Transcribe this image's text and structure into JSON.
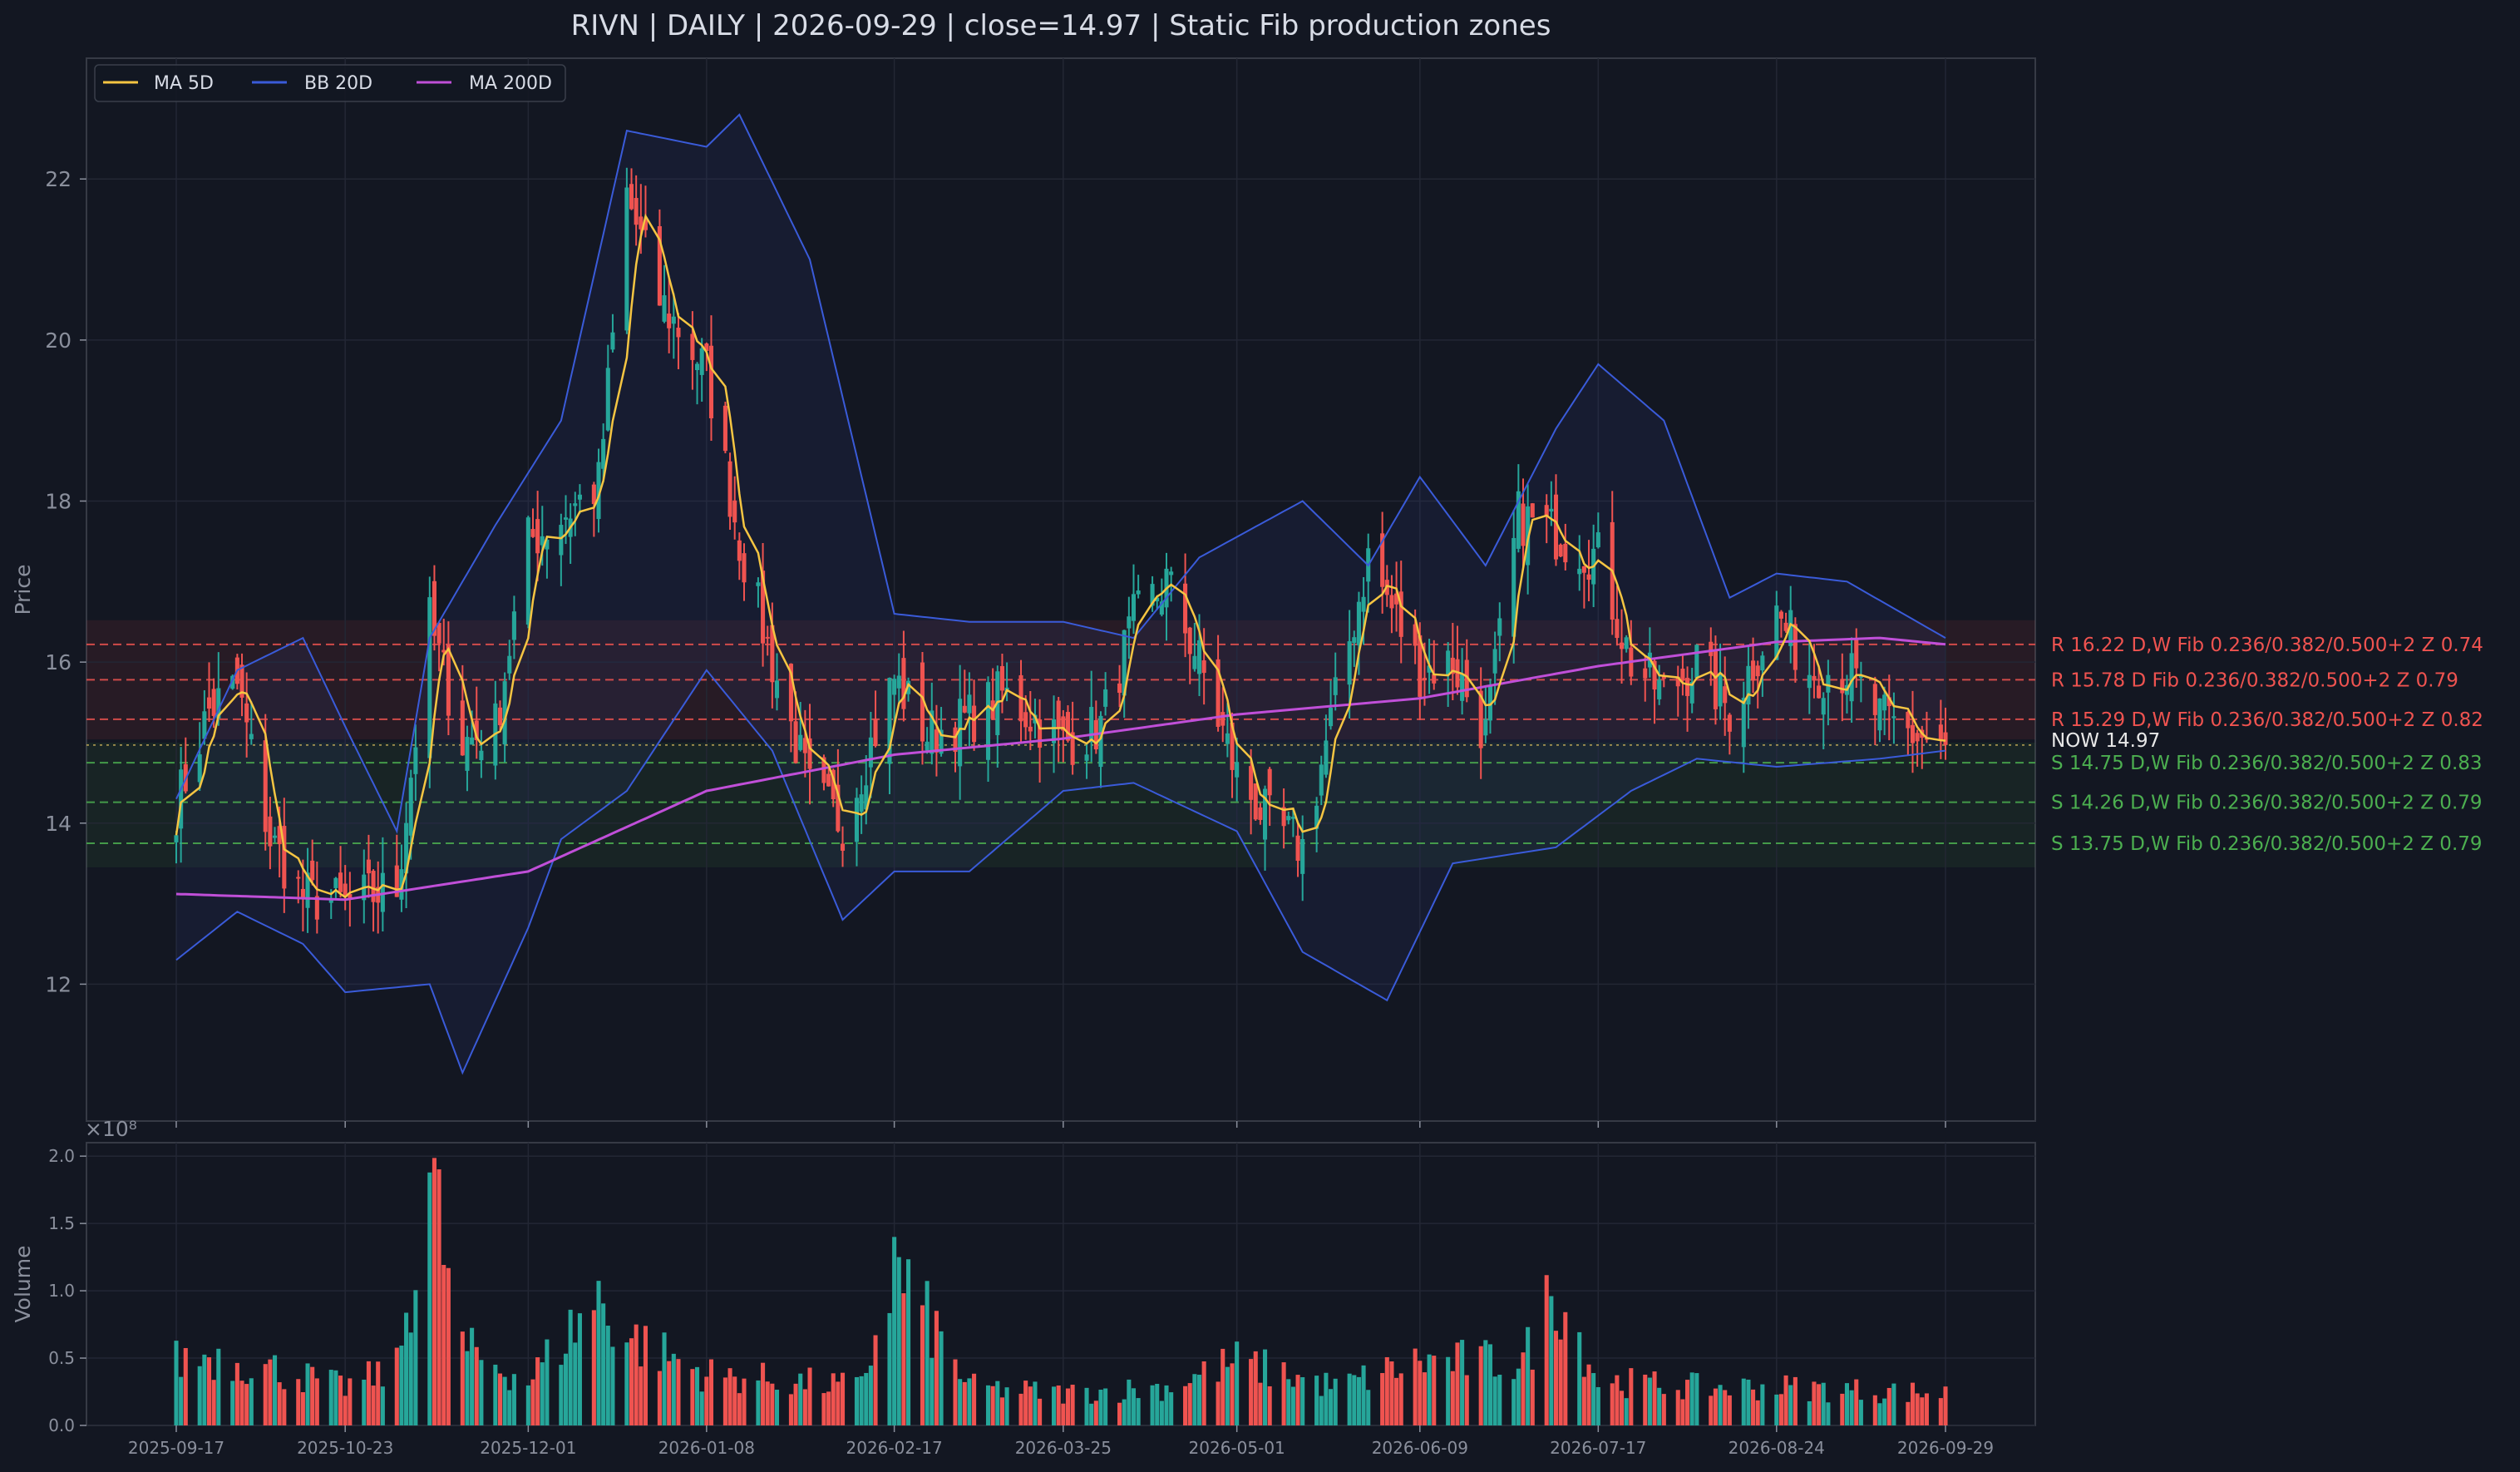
{
  "chart_data": {
    "type": "candlestick",
    "title": "RIVN  |  DAILY  |  2026-09-29  |  close=14.97  |  Static Fib production zones",
    "ylabel": "Price",
    "volume_ylabel": "Volume",
    "volume_multiplier_label": "×10⁸",
    "ylim": [
      10.3,
      23.5
    ],
    "yticks": [
      12,
      14,
      16,
      18,
      20,
      22
    ],
    "volume_ylim": [
      0,
      2.1
    ],
    "volume_yticks": [
      "0.0",
      "0.5",
      "1.0",
      "1.5",
      "2.0"
    ],
    "x_tick_labels": [
      "2025-09-17",
      "2025-10-23",
      "2025-12-01",
      "2026-01-08",
      "2026-02-17",
      "2026-03-25",
      "2026-05-01",
      "2026-06-09",
      "2026-07-17",
      "2026-08-24",
      "2026-09-29"
    ],
    "legend": [
      {
        "name": "MA 5D",
        "color": "#f5c542"
      },
      {
        "name": "BB 20D",
        "color": "#3a5bd9"
      },
      {
        "name": "MA 200D",
        "color": "#c04fd8"
      }
    ],
    "legend_position": "top-left",
    "grid": true,
    "close_price": 14.97,
    "now_label": "NOW 14.97",
    "zones": [
      {
        "level": 16.22,
        "label": "R 16.22  D,W  Fib 0.236/0.382/0.500+2  Z 0.74",
        "kind": "resistance"
      },
      {
        "level": 15.78,
        "label": "R 15.78  D  Fib 0.236/0.382/0.500+2  Z 0.79",
        "kind": "resistance"
      },
      {
        "level": 15.29,
        "label": "R 15.29  D,W  Fib 0.236/0.382/0.500+2  Z 0.82",
        "kind": "resistance"
      },
      {
        "level": 14.75,
        "label": "S 14.75  D,W  Fib 0.236/0.382/0.500+2  Z 0.83",
        "kind": "support"
      },
      {
        "level": 14.26,
        "label": "S 14.26  D,W  Fib 0.236/0.382/0.500+2  Z 0.79",
        "kind": "support"
      },
      {
        "level": 13.75,
        "label": "S 13.75  D,W  Fib 0.236/0.382/0.500+2  Z 0.79",
        "kind": "support"
      }
    ],
    "colors": {
      "up": "#26a69a",
      "down": "#ef5350",
      "resistance": "#ef5350",
      "support": "#4caf50",
      "background": "#131722"
    },
    "close_anchors": [
      [
        "2025-09-17",
        14.2
      ],
      [
        "2025-09-24",
        15.4
      ],
      [
        "2025-09-30",
        15.7
      ],
      [
        "2025-10-07",
        13.8
      ],
      [
        "2025-10-14",
        13.1
      ],
      [
        "2025-10-23",
        13.0
      ],
      [
        "2025-11-03",
        13.2
      ],
      [
        "2025-11-10",
        16.5
      ],
      [
        "2025-11-17",
        15.0
      ],
      [
        "2025-11-24",
        15.2
      ],
      [
        "2025-12-01",
        17.5
      ],
      [
        "2025-12-08",
        17.8
      ],
      [
        "2025-12-16",
        18.2
      ],
      [
        "2025-12-22",
        21.8
      ],
      [
        "2025-12-29",
        20.5
      ],
      [
        "2026-01-08",
        19.6
      ],
      [
        "2026-01-15",
        17.5
      ],
      [
        "2026-01-22",
        16.0
      ],
      [
        "2026-01-30",
        14.4
      ],
      [
        "2026-02-06",
        14.0
      ],
      [
        "2026-02-17",
        15.8
      ],
      [
        "2026-02-24",
        15.1
      ],
      [
        "2026-03-05",
        15.3
      ],
      [
        "2026-03-12",
        15.6
      ],
      [
        "2026-03-19",
        15.3
      ],
      [
        "2026-03-25",
        15.0
      ],
      [
        "2026-04-02",
        15.2
      ],
      [
        "2026-04-09",
        16.5
      ],
      [
        "2026-04-16",
        17.0
      ],
      [
        "2026-04-23",
        16.0
      ],
      [
        "2026-05-01",
        14.6
      ],
      [
        "2026-05-08",
        14.0
      ],
      [
        "2026-05-15",
        13.7
      ],
      [
        "2026-05-22",
        15.5
      ],
      [
        "2026-05-29",
        17.3
      ],
      [
        "2026-06-09",
        15.9
      ],
      [
        "2026-06-16",
        16.0
      ],
      [
        "2026-06-23",
        15.1
      ],
      [
        "2026-06-30",
        17.8
      ],
      [
        "2026-07-08",
        17.6
      ],
      [
        "2026-07-17",
        17.3
      ],
      [
        "2026-07-24",
        16.0
      ],
      [
        "2026-07-31",
        15.6
      ],
      [
        "2026-08-07",
        16.0
      ],
      [
        "2026-08-14",
        15.4
      ],
      [
        "2026-08-24",
        16.6
      ],
      [
        "2026-08-31",
        15.9
      ],
      [
        "2026-09-08",
        15.9
      ],
      [
        "2026-09-15",
        15.3
      ],
      [
        "2026-09-22",
        15.1
      ],
      [
        "2026-09-29",
        14.97
      ]
    ],
    "ma200_anchors": [
      [
        "2025-09-17",
        13.12
      ],
      [
        "2025-10-23",
        13.05
      ],
      [
        "2025-12-01",
        13.4
      ],
      [
        "2026-01-08",
        14.4
      ],
      [
        "2026-02-17",
        14.85
      ],
      [
        "2026-03-25",
        15.05
      ],
      [
        "2026-05-01",
        15.35
      ],
      [
        "2026-06-09",
        15.55
      ],
      [
        "2026-07-17",
        15.95
      ],
      [
        "2026-08-24",
        16.25
      ],
      [
        "2026-09-15",
        16.3
      ],
      [
        "2026-09-29",
        16.22
      ]
    ],
    "bb_upper_anchors": [
      [
        "2025-09-17",
        14.3
      ],
      [
        "2025-09-30",
        15.9
      ],
      [
        "2025-10-14",
        16.3
      ],
      [
        "2025-10-23",
        15.2
      ],
      [
        "2025-11-03",
        13.9
      ],
      [
        "2025-11-10",
        16.3
      ],
      [
        "2025-11-24",
        17.7
      ],
      [
        "2025-12-08",
        19.0
      ],
      [
        "2025-12-22",
        22.6
      ],
      [
        "2026-01-08",
        22.4
      ],
      [
        "2026-01-15",
        22.8
      ],
      [
        "2026-01-30",
        21.0
      ],
      [
        "2026-02-17",
        16.6
      ],
      [
        "2026-03-05",
        16.5
      ],
      [
        "2026-03-25",
        16.5
      ],
      [
        "2026-04-09",
        16.3
      ],
      [
        "2026-04-23",
        17.3
      ],
      [
        "2026-05-15",
        18.0
      ],
      [
        "2026-05-29",
        17.2
      ],
      [
        "2026-06-09",
        18.3
      ],
      [
        "2026-06-23",
        17.2
      ],
      [
        "2026-07-08",
        18.9
      ],
      [
        "2026-07-17",
        19.7
      ],
      [
        "2026-07-31",
        19.0
      ],
      [
        "2026-08-14",
        16.8
      ],
      [
        "2026-08-24",
        17.1
      ],
      [
        "2026-09-08",
        17.0
      ],
      [
        "2026-09-29",
        16.3
      ]
    ],
    "bb_lower_anchors": [
      [
        "2025-09-17",
        12.3
      ],
      [
        "2025-09-30",
        12.9
      ],
      [
        "2025-10-14",
        12.5
      ],
      [
        "2025-10-23",
        11.9
      ],
      [
        "2025-11-10",
        12.0
      ],
      [
        "2025-11-17",
        10.9
      ],
      [
        "2025-12-01",
        12.7
      ],
      [
        "2025-12-08",
        13.8
      ],
      [
        "2025-12-22",
        14.4
      ],
      [
        "2026-01-08",
        15.9
      ],
      [
        "2026-01-22",
        14.9
      ],
      [
        "2026-02-06",
        12.8
      ],
      [
        "2026-02-17",
        13.4
      ],
      [
        "2026-03-05",
        13.4
      ],
      [
        "2026-03-25",
        14.4
      ],
      [
        "2026-04-09",
        14.5
      ],
      [
        "2026-05-01",
        13.9
      ],
      [
        "2026-05-15",
        12.4
      ],
      [
        "2026-06-02",
        11.8
      ],
      [
        "2026-06-16",
        13.5
      ],
      [
        "2026-07-08",
        13.7
      ],
      [
        "2026-07-24",
        14.4
      ],
      [
        "2026-08-07",
        14.8
      ],
      [
        "2026-08-24",
        14.7
      ],
      [
        "2026-09-15",
        14.8
      ],
      [
        "2026-09-29",
        14.9
      ]
    ],
    "volume_anchors": [
      [
        "2025-09-17",
        0.5
      ],
      [
        "2025-09-24",
        0.55
      ],
      [
        "2025-10-07",
        0.45
      ],
      [
        "2025-10-23",
        0.3
      ],
      [
        "2025-11-03",
        0.45
      ],
      [
        "2025-11-10",
        1.97
      ],
      [
        "2025-11-17",
        0.6
      ],
      [
        "2025-12-01",
        0.35
      ],
      [
        "2025-12-16",
        1.0
      ],
      [
        "2025-12-22",
        0.7
      ],
      [
        "2026-01-08",
        0.4
      ],
      [
        "2026-02-10",
        0.3
      ],
      [
        "2026-02-17",
        1.25
      ],
      [
        "2026-03-05",
        0.3
      ],
      [
        "2026-03-25",
        0.25
      ],
      [
        "2026-04-16",
        0.3
      ],
      [
        "2026-05-01",
        0.5
      ],
      [
        "2026-05-22",
        0.3
      ],
      [
        "2026-06-09",
        0.5
      ],
      [
        "2026-07-01",
        0.5
      ],
      [
        "2026-07-08",
        1.1
      ],
      [
        "2026-07-17",
        0.35
      ],
      [
        "2026-08-07",
        0.3
      ],
      [
        "2026-08-24",
        0.3
      ],
      [
        "2026-09-29",
        0.25
      ]
    ]
  }
}
